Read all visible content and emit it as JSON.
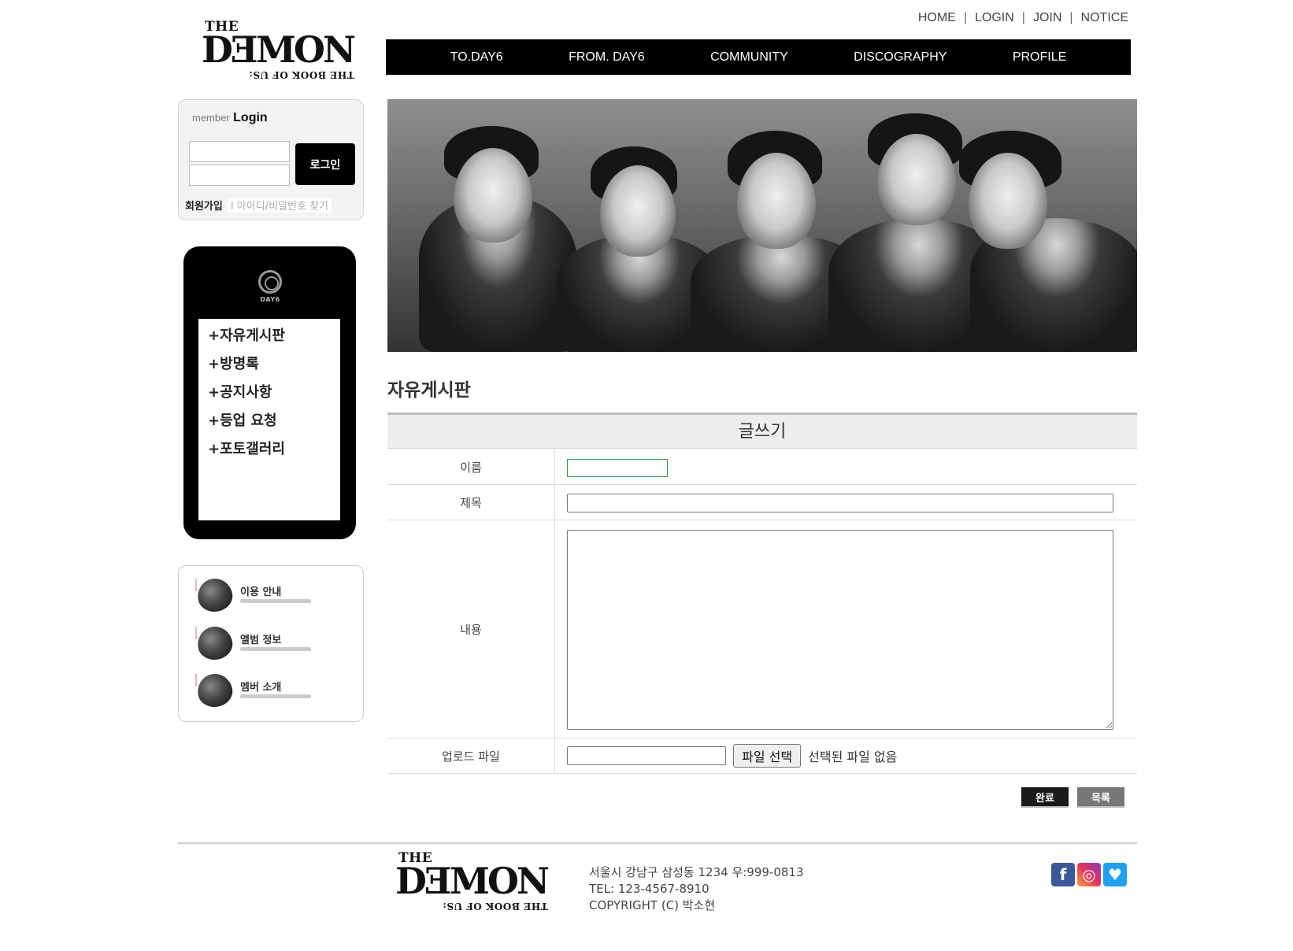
{
  "logo": {
    "the": "THE",
    "name": "DƎMON",
    "sub": "THE BOOK OF US:"
  },
  "topnav": [
    "HOME",
    "LOGIN",
    "JOIN",
    "NOTICE"
  ],
  "mainnav": [
    "TO.DAY6",
    "FROM. DAY6",
    "COMMUNITY",
    "DISCOGRAPHY",
    "PROFILE"
  ],
  "login": {
    "title_small": "member",
    "title_big": "Login",
    "button": "로그인",
    "join_link": "회원가입",
    "find_link": "I 아이디/비밀번호 찾기"
  },
  "sidemenu": {
    "logo_text": "DAY6",
    "items": [
      "+자유게시판",
      "+방명록",
      "+공지사항",
      "+등업 요청",
      "+포토갤러리"
    ]
  },
  "infobox": {
    "items": [
      "이용 안내",
      "앨범 정보",
      "멤버 소개"
    ],
    "icon": "heart-icon"
  },
  "board": {
    "title": "자유게시판",
    "form_title": "글쓰기",
    "labels": {
      "name": "이름",
      "subject": "제목",
      "content": "내용",
      "file": "업로드 파일"
    },
    "file_button": "파일 선택",
    "file_none": "선택된 파일 없음",
    "done_button": "완료",
    "list_button": "목록"
  },
  "footer": {
    "address": "서울시 강남구 삼성동 1234 우:999-0813",
    "tel": "TEL: 123-4567-8910",
    "copyright": "COPYRIGHT (C) 박소현",
    "sns": [
      "facebook-icon",
      "instagram-icon",
      "twitter-icon"
    ]
  },
  "colors": {
    "nav_bg": "#000000",
    "form_head_bg": "#eeeeee",
    "facebook": "#3b5998",
    "twitter": "#1da1f2"
  }
}
